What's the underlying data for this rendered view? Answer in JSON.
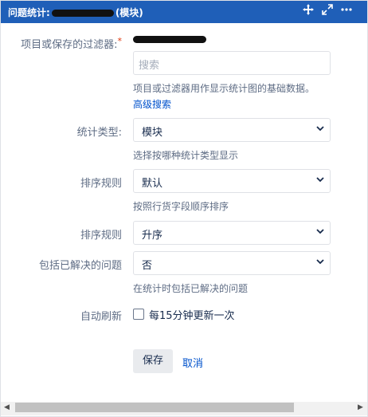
{
  "header": {
    "title_prefix": "问题统计:",
    "title_suffix": "(模块)",
    "icons": [
      "move-icon",
      "expand-icon",
      "more-icon"
    ]
  },
  "form": {
    "filter": {
      "label": "项目或保存的过滤器:",
      "required_mark": "*",
      "search_placeholder": "搜索",
      "help": "项目或过滤器用作显示统计图的基础数据。",
      "advanced_link": "高级搜索"
    },
    "stat_type": {
      "label": "统计类型:",
      "value": "模块",
      "help": "选择按哪种统计类型显示"
    },
    "sort_by": {
      "label": "排序规则",
      "value": "默认",
      "help": "按照行货字段顺序排序"
    },
    "sort_order": {
      "label": "排序规则",
      "value": "升序"
    },
    "include_resolved": {
      "label": "包括已解决的问题",
      "value": "否",
      "help": "在统计时包括已解决的问题"
    },
    "auto_refresh": {
      "label": "自动刷新",
      "checkbox_label": "每15分钟更新一次",
      "checked": false
    }
  },
  "actions": {
    "save": "保存",
    "cancel": "取消"
  },
  "colors": {
    "header_bg": "#1f5fb8",
    "link": "#0052cc"
  }
}
